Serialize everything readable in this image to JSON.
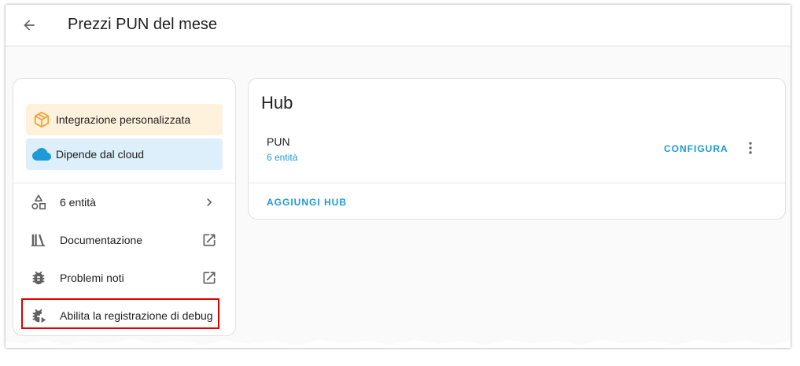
{
  "header": {
    "title": "Prezzi PUN del mese",
    "back_icon": "arrow-left-icon"
  },
  "info_panel": {
    "badges": [
      {
        "label": "Integrazione personalizzata",
        "icon": "package-icon",
        "color": "#f2a43a",
        "background": "#fff2dc"
      },
      {
        "label": "Dipende dal cloud",
        "icon": "cloud-icon",
        "color": "#1e9ad6",
        "background": "#ddeffa"
      }
    ],
    "links": [
      {
        "label": "6 entità",
        "icon": "shapes-icon",
        "trailing_icon": "chevron-right-icon"
      },
      {
        "label": "Documentazione",
        "icon": "bookshelf-icon",
        "trailing_icon": "open-in-new-icon"
      },
      {
        "label": "Problemi noti",
        "icon": "bug-icon",
        "trailing_icon": "open-in-new-icon"
      },
      {
        "label": "Abilita la registrazione di debug",
        "icon": "bug-play-icon"
      }
    ]
  },
  "hub_card": {
    "title": "Hub",
    "entry": {
      "name": "PUN",
      "entities": "6 entità"
    },
    "configure_label": "CONFIGURA",
    "add_label": "AGGIUNGI HUB"
  },
  "colors": {
    "accent": "#1e9ad6",
    "highlight": "#e00000"
  }
}
